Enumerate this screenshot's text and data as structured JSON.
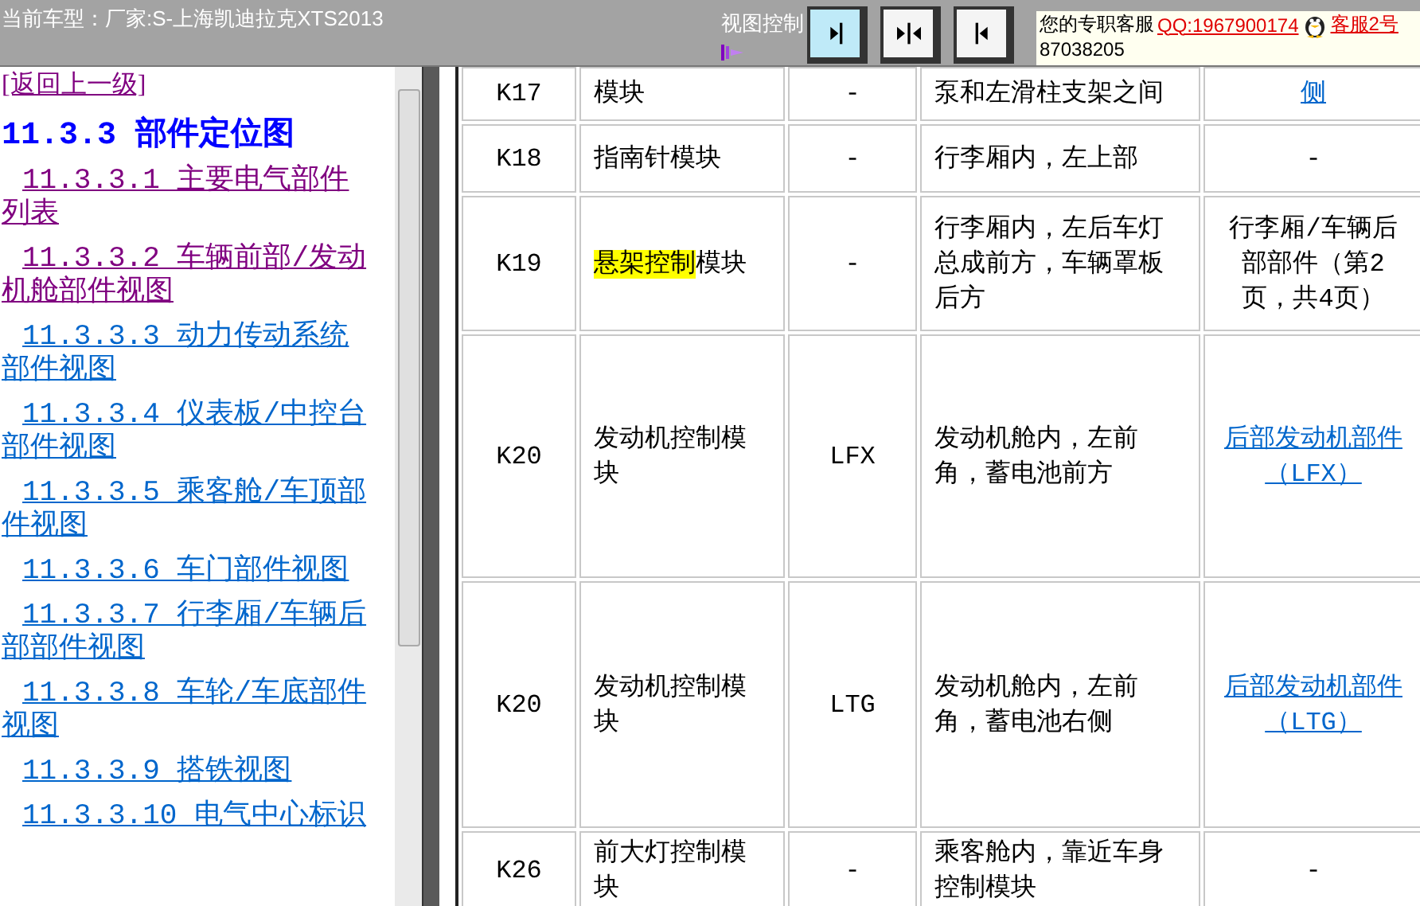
{
  "header": {
    "title": "当前车型：厂家:S-上海凯迪拉克XTS2013",
    "view_control_label": "视图控制",
    "view_buttons": [
      {
        "kind": "expand-right",
        "selected": true
      },
      {
        "kind": "center",
        "selected": false
      },
      {
        "kind": "expand-left",
        "selected": false
      }
    ],
    "service": {
      "label": "您的专职客服",
      "qq": "QQ:1967900174",
      "agent": "客服2号",
      "number": "87038205"
    }
  },
  "nav": {
    "back": "[返回上一级]",
    "heading": "11.3.3 部件定位图",
    "items": [
      {
        "label": "11.3.3.1 主要电气部件列表",
        "visited": true
      },
      {
        "label": "11.3.3.2 车辆前部/发动机舱部件视图",
        "visited": true
      },
      {
        "label": "11.3.3.3 动力传动系统部件视图",
        "visited": false
      },
      {
        "label": "11.3.3.4 仪表板/中控台部件视图",
        "visited": false
      },
      {
        "label": "11.3.3.5 乘客舱/车顶部件视图",
        "visited": false
      },
      {
        "label": "11.3.3.6 车门部件视图",
        "visited": false
      },
      {
        "label": "11.3.3.7 行李厢/车辆后部部件视图",
        "visited": false
      },
      {
        "label": "11.3.3.8 车轮/车底部件视图",
        "visited": false
      },
      {
        "label": "11.3.3.9 搭铁视图",
        "visited": false
      },
      {
        "label": "11.3.3.10 电气中心标识",
        "visited": false
      }
    ]
  },
  "table": {
    "rows": [
      {
        "code": "K17",
        "name": [
          {
            "text": "模块",
            "highlighted": false
          }
        ],
        "engine": "-",
        "location": "泵和左滑柱支架之间",
        "view": {
          "text": "侧",
          "link": true
        }
      },
      {
        "code": "K18",
        "name": [
          {
            "text": "指南针模块",
            "highlighted": false
          }
        ],
        "engine": "-",
        "location": "行李厢内，左上部",
        "view": {
          "text": "-",
          "link": false
        }
      },
      {
        "code": "K19",
        "name": [
          {
            "text": "悬架控制",
            "highlighted": true
          },
          {
            "text": "模块",
            "highlighted": false
          }
        ],
        "engine": "-",
        "location": "行李厢内，左后车灯总成前方，车辆罩板后方",
        "view": {
          "text": "行李厢/车辆后部部件（第2页，共4页）",
          "link": false
        }
      },
      {
        "code": "K20",
        "name": [
          {
            "text": "发动机控制模块",
            "highlighted": false
          }
        ],
        "engine": "LFX",
        "location": "发动机舱内，左前角，蓄电池前方",
        "view": {
          "text": "后部发动机部件（LFX）",
          "link": true
        }
      },
      {
        "code": "K20",
        "name": [
          {
            "text": "发动机控制模块",
            "highlighted": false
          }
        ],
        "engine": "LTG",
        "location": "发动机舱内，左前角，蓄电池右侧",
        "view": {
          "text": "后部发动机部件（LTG）",
          "link": true
        }
      },
      {
        "code": "K26",
        "name": [
          {
            "text": "前大灯控制模块",
            "highlighted": false
          }
        ],
        "engine": "-",
        "location": "乘客舱内，靠近车身控制模块",
        "view": {
          "text": "-",
          "link": false
        }
      }
    ]
  }
}
